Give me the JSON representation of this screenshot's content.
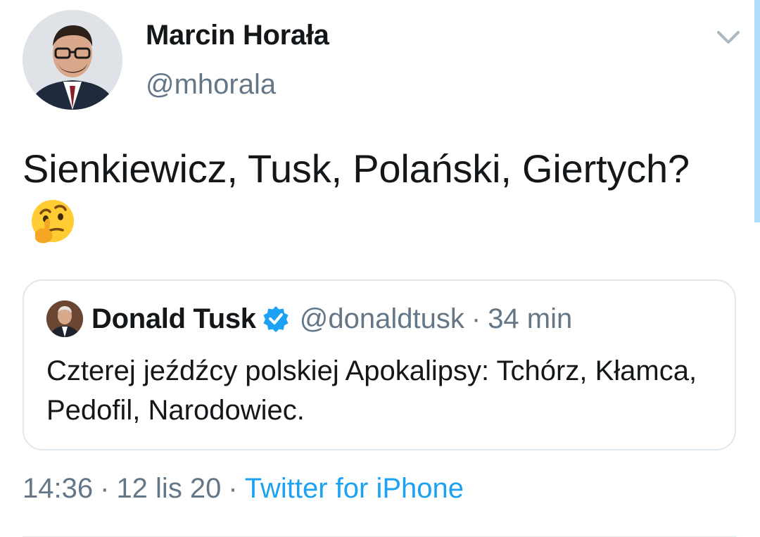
{
  "tweet": {
    "author_name": "Marcin Horała",
    "author_handle": "@mhorala",
    "text": "Sienkiewicz, Tusk, Polański, Giertych?",
    "emoji": "thinking-face",
    "time": "14:36",
    "date": "12 lis 20",
    "separator": "·",
    "source": "Twitter for iPhone"
  },
  "quoted_tweet": {
    "author_name": "Donald Tusk",
    "verified": true,
    "author_handle": "@donaldtusk",
    "separator": "·",
    "time": "34 min",
    "text": "Czterej jeźdźcy polskiej Apokalipsy: Tchórz, Kłamca, Pedofil, Narodowiec."
  },
  "icons": {
    "menu": "chevron-down-icon",
    "verified": "verified-badge-icon"
  },
  "colors": {
    "link": "#1da1f2",
    "secondary_text": "#657786",
    "border": "#e1e8ed"
  }
}
